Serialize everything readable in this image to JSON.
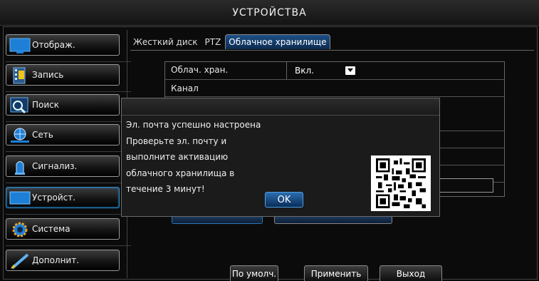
{
  "window": {
    "title": "УСТРОЙСТВА"
  },
  "sidebar": {
    "items": [
      {
        "label": "Отображ.",
        "icon": "monitor-icon"
      },
      {
        "label": "Запись",
        "icon": "film-icon"
      },
      {
        "label": "Поиск",
        "icon": "search-icon"
      },
      {
        "label": "Сеть",
        "icon": "network-icon"
      },
      {
        "label": "Сигнализ.",
        "icon": "alarm-icon"
      },
      {
        "label": "Устройст.",
        "icon": "device-icon",
        "active": true
      },
      {
        "label": "Система",
        "icon": "gear-icon"
      },
      {
        "label": "Дополнит.",
        "icon": "pen-icon"
      }
    ]
  },
  "tabs": [
    {
      "label": "Жесткий диск"
    },
    {
      "label": "PTZ"
    },
    {
      "label": "Облачное хранилище",
      "active": true
    }
  ],
  "settings": {
    "cloud_label": "Облач. хран.",
    "cloud_value": "Вкл.",
    "channel_label": "Канал"
  },
  "dialog": {
    "lines": [
      "Эл. почта успешно настроена",
      "Проверьте эл. почту и",
      "выполните активацию",
      "облачного хранилища в",
      "течение 3 минут!"
    ],
    "ok_label": "OK"
  },
  "footer": {
    "default_label": "По умолч.",
    "apply_label": "Применить",
    "exit_label": "Выход"
  },
  "colors": {
    "accent": "#2c6db0",
    "active_tab": "#1d4f86",
    "icon_blue": "#1e7fd6"
  }
}
